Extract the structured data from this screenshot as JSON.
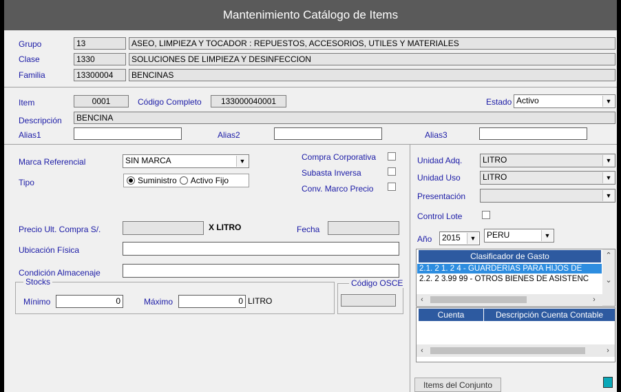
{
  "window": {
    "title": "Mantenimiento Catálogo de Items"
  },
  "header": {
    "grupo": {
      "label": "Grupo",
      "code": "13",
      "desc": "ASEO, LIMPIEZA Y TOCADOR  :  REPUESTOS, ACCESORIOS, UTILES Y MATERIALES"
    },
    "clase": {
      "label": "Clase",
      "code": "1330",
      "desc": "SOLUCIONES DE LIMPIEZA Y DESINFECCION"
    },
    "familia": {
      "label": "Familia",
      "code": "13300004",
      "desc": "BENCINAS"
    }
  },
  "item": {
    "item_label": "Item",
    "item_value": "0001",
    "codigo_label": "Código Completo",
    "codigo_value": "133000040001",
    "estado_label": "Estado",
    "estado_value": "Activo",
    "descripcion_label": "Descripción",
    "descripcion_value": "BENCINA",
    "alias1_label": "Alias1",
    "alias1_value": "",
    "alias2_label": "Alias2",
    "alias2_value": "",
    "alias3_label": "Alias3",
    "alias3_value": ""
  },
  "left": {
    "marca_label": "Marca Referencial",
    "marca_value": "SIN MARCA",
    "tipo_label": "Tipo",
    "tipo_opt1": "Suministro",
    "tipo_opt2": "Activo Fijo",
    "compra_corp_label": "Compra Corporativa",
    "subasta_label": "Subasta Inversa",
    "conv_marco_label": "Conv. Marco Precio",
    "precio_label": "Precio Ult. Compra S/.",
    "precio_value": "",
    "x_unit": "X LITRO",
    "fecha_label": "Fecha",
    "fecha_value": "",
    "ubicacion_label": "Ubicación Física",
    "ubicacion_value": "",
    "condicion_label": "Condición Almacenaje",
    "condicion_value": "",
    "stocks_legend": "Stocks",
    "minimo_label": "Mínimo",
    "minimo_value": "0",
    "maximo_label": "Máximo",
    "maximo_value": "0",
    "stock_unit": "LITRO",
    "osce_legend": "Código OSCE",
    "osce_value": ""
  },
  "right": {
    "unidad_adq_label": "Unidad Adq.",
    "unidad_adq_value": "LITRO",
    "unidad_uso_label": "Unidad Uso",
    "unidad_uso_value": "LITRO",
    "presentacion_label": "Presentación",
    "presentacion_value": "",
    "control_lote_label": "Control Lote",
    "anio_label": "Año",
    "anio_value": "2015",
    "pais_value": "PERU",
    "clasificador_header": "Clasificador de Gasto",
    "clasificador_rows": [
      "2.1. 2  1. 2  4 - GUARDERIAS PARA HIJOS DE",
      "2.2. 2  3.99 99 - OTROS BIENES DE ASISTENC"
    ],
    "cuenta_header": "Cuenta",
    "desc_cuenta_header": "Descripción Cuenta Contable",
    "items_conjunto_label": "Items del Conjunto"
  }
}
